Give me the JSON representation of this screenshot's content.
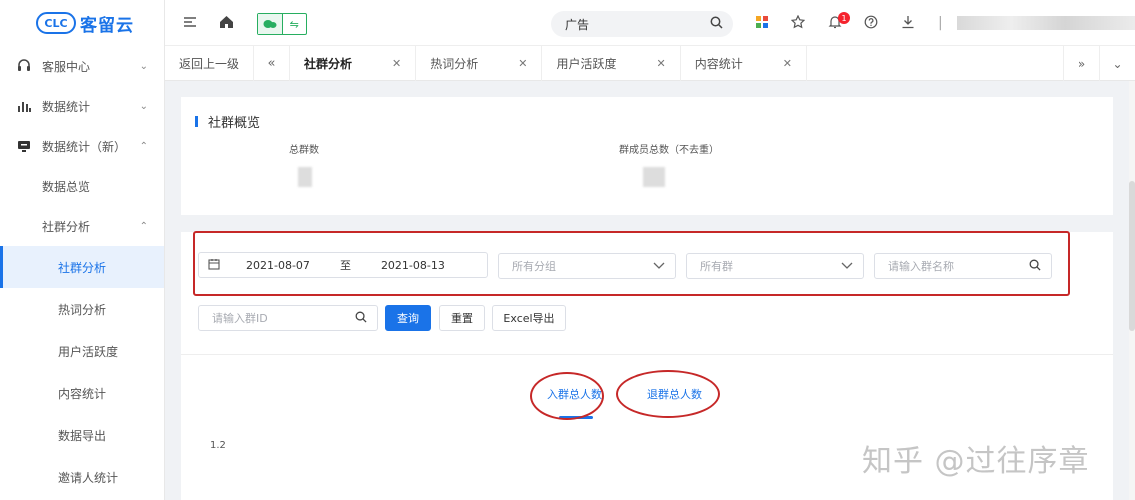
{
  "brand": {
    "logo_mark": "CLC",
    "name": "客留云"
  },
  "sidebar": {
    "groups": [
      {
        "label": "客服中心",
        "icon": "headset-icon",
        "chevron": "⌄"
      },
      {
        "label": "数据统计",
        "icon": "bar-chart-icon",
        "chevron": "⌄"
      },
      {
        "label": "数据统计（新）",
        "icon": "monitor-icon",
        "chevron": "⌃"
      }
    ],
    "sub_items": [
      {
        "label": "数据总览"
      },
      {
        "label": "社群分析",
        "chevron": "⌃"
      }
    ],
    "sub2_items": [
      {
        "label": "社群分析",
        "active": true
      },
      {
        "label": "热词分析"
      },
      {
        "label": "用户活跃度"
      },
      {
        "label": "内容统计"
      },
      {
        "label": "数据导出"
      },
      {
        "label": "邀请人统计"
      }
    ]
  },
  "topbar": {
    "search_value": "广告",
    "notification_count": "1"
  },
  "tabs": {
    "back_label": "返回上一级",
    "items": [
      {
        "label": "社群分析",
        "active": true
      },
      {
        "label": "热词分析"
      },
      {
        "label": "用户活跃度"
      },
      {
        "label": "内容统计"
      }
    ]
  },
  "overview": {
    "title": "社群概览",
    "total_groups_label": "总群数",
    "total_members_label": "群成员总数（不去重）"
  },
  "filters": {
    "date_start": "2021-08-07",
    "date_sep": "至",
    "date_end": "2021-08-13",
    "group_category_placeholder": "所有分组",
    "group_placeholder": "所有群",
    "group_name_placeholder": "请输入群名称",
    "group_id_placeholder": "请输入群ID",
    "query_button": "查询",
    "reset_button": "重置",
    "export_button": "Excel导出"
  },
  "chart_tabs": {
    "join": "入群总人数",
    "leave": "退群总人数"
  },
  "chart_data": {
    "type": "line",
    "y_tick_visible": "1.2"
  },
  "watermark": "知乎 @过往序章",
  "colors": {
    "primary": "#1a73e8",
    "annotation": "#c62828"
  }
}
